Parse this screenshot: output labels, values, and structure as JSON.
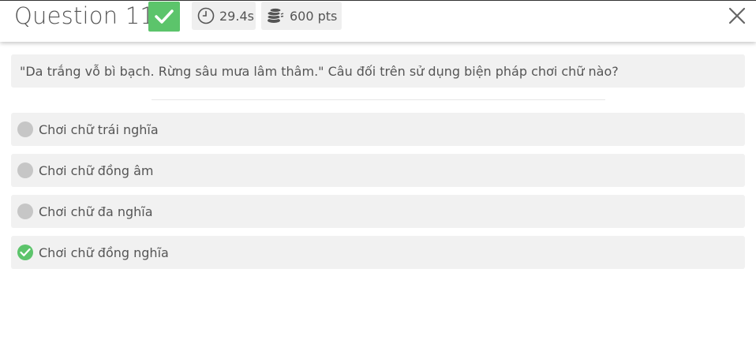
{
  "header": {
    "title": "Question 11",
    "timer": "29.4s",
    "points": "600 pts"
  },
  "question": {
    "text": "\"Da trắng vỗ bì bạch. Rừng sâu mưa lâm thâm.\" Câu đối trên sử dụng biện pháp chơi chữ nào?"
  },
  "options": [
    {
      "label": "Chơi chữ trái nghĩa",
      "correct": false
    },
    {
      "label": "Chơi chữ đồng âm",
      "correct": false
    },
    {
      "label": "Chơi chữ đa nghĩa",
      "correct": false
    },
    {
      "label": "Chơi chữ đồng nghĩa",
      "correct": true
    }
  ],
  "colors": {
    "correct": "#5cc46b",
    "neutral_radio": "#c6c6c6",
    "panel_bg": "#f1f1f1"
  },
  "icons": {
    "correct_badge": "check-icon",
    "timer": "clock-icon",
    "points": "coins-icon",
    "close": "close-icon"
  }
}
